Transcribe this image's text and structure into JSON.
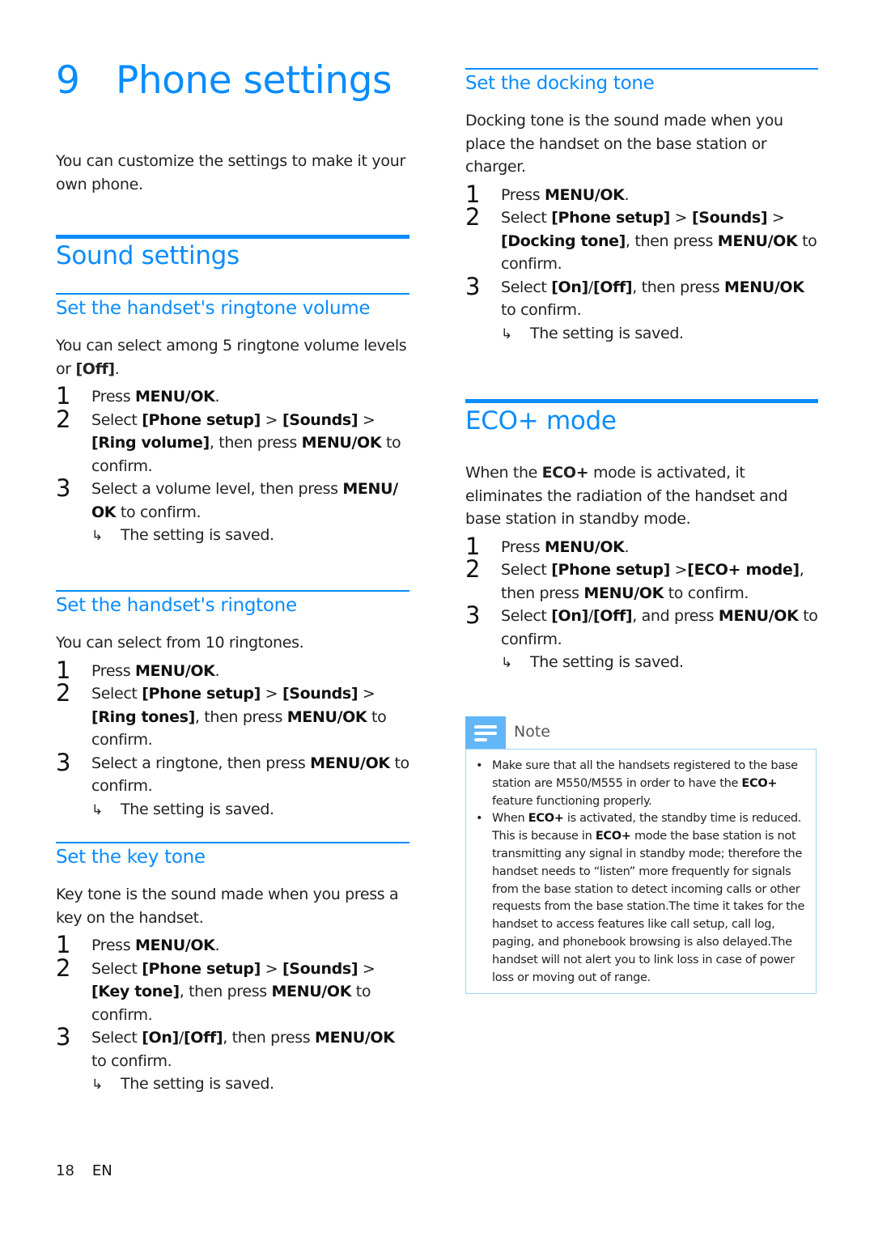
{
  "chapter": {
    "number": "9",
    "title": "Phone settings"
  },
  "intro": "You can customize the settings to make it your own phone.",
  "sound_settings": {
    "title": "Sound settings",
    "ringtone_volume": {
      "title": "Set the handset's ringtone volume",
      "description_pre": "You can select among 5 ringtone volume levels or ",
      "description_bold": "[Off]",
      "description_post": ".",
      "steps": [
        {
          "n": "1",
          "parts": [
            {
              "t": "Press "
            },
            {
              "b": "MENU/OK"
            },
            {
              "t": "."
            }
          ]
        },
        {
          "n": "2",
          "parts": [
            {
              "t": "Select "
            },
            {
              "b": "[Phone setup]"
            },
            {
              "t": " > "
            },
            {
              "b": "[Sounds]"
            },
            {
              "t": " > "
            },
            {
              "b": "[Ring volume]"
            },
            {
              "t": ", then press "
            },
            {
              "b": "MENU/OK"
            },
            {
              "t": " to confirm."
            }
          ]
        },
        {
          "n": "3",
          "parts": [
            {
              "t": "Select a volume level, then press "
            },
            {
              "b": "MENU/ OK"
            },
            {
              "t": " to confirm."
            }
          ]
        }
      ],
      "result": "The setting is saved."
    },
    "ringtone": {
      "title": "Set the handset's ringtone",
      "description": "You can select from 10 ringtones.",
      "steps": [
        {
          "n": "1",
          "parts": [
            {
              "t": "Press "
            },
            {
              "b": "MENU/OK"
            },
            {
              "t": "."
            }
          ]
        },
        {
          "n": "2",
          "parts": [
            {
              "t": "Select "
            },
            {
              "b": "[Phone setup]"
            },
            {
              "t": " > "
            },
            {
              "b": "[Sounds]"
            },
            {
              "t": " > "
            },
            {
              "b": "[Ring tones]"
            },
            {
              "t": ", then press "
            },
            {
              "b": "MENU/OK"
            },
            {
              "t": " to confirm."
            }
          ]
        },
        {
          "n": "3",
          "parts": [
            {
              "t": "Select a ringtone, then press "
            },
            {
              "b": "MENU/OK"
            },
            {
              "t": " to confirm."
            }
          ]
        }
      ],
      "result": "The setting is saved."
    },
    "key_tone": {
      "title": "Set the key tone",
      "description": "Key tone is the sound made when you press a key on the handset.",
      "steps": [
        {
          "n": "1",
          "parts": [
            {
              "t": "Press "
            },
            {
              "b": "MENU/OK"
            },
            {
              "t": "."
            }
          ]
        },
        {
          "n": "2",
          "parts": [
            {
              "t": "Select "
            },
            {
              "b": "[Phone setup]"
            },
            {
              "t": " > "
            },
            {
              "b": "[Sounds]"
            },
            {
              "t": " > "
            },
            {
              "b": "[Key tone]"
            },
            {
              "t": ", then press "
            },
            {
              "b": "MENU/OK"
            },
            {
              "t": " to confirm."
            }
          ]
        },
        {
          "n": "3",
          "parts": [
            {
              "t": "Select "
            },
            {
              "b": "[On]"
            },
            {
              "t": "/"
            },
            {
              "b": "[Off]"
            },
            {
              "t": ", then press "
            },
            {
              "b": "MENU/OK"
            },
            {
              "t": " to confirm."
            }
          ]
        }
      ],
      "result": "The setting is saved."
    },
    "docking_tone": {
      "title": "Set the docking tone",
      "description": "Docking tone is the sound made when you place the handset on the base station or charger.",
      "steps": [
        {
          "n": "1",
          "parts": [
            {
              "t": "Press "
            },
            {
              "b": "MENU/OK"
            },
            {
              "t": "."
            }
          ]
        },
        {
          "n": "2",
          "parts": [
            {
              "t": "Select "
            },
            {
              "b": "[Phone setup]"
            },
            {
              "t": " > "
            },
            {
              "b": "[Sounds]"
            },
            {
              "t": " > "
            },
            {
              "b": "[Docking tone]"
            },
            {
              "t": ", then press "
            },
            {
              "b": "MENU/OK"
            },
            {
              "t": " to confirm."
            }
          ]
        },
        {
          "n": "3",
          "parts": [
            {
              "t": "Select "
            },
            {
              "b": "[On]"
            },
            {
              "t": "/"
            },
            {
              "b": "[Off]"
            },
            {
              "t": ", then press "
            },
            {
              "b": "MENU/OK"
            },
            {
              "t": " to confirm."
            }
          ]
        }
      ],
      "result": "The setting is saved."
    }
  },
  "eco_mode": {
    "title": "ECO+ mode",
    "description_parts": [
      {
        "t": "When the "
      },
      {
        "b": "ECO+"
      },
      {
        "t": " mode is activated, it eliminates the radiation of the handset and base station in standby mode."
      }
    ],
    "steps": [
      {
        "n": "1",
        "parts": [
          {
            "t": "Press "
          },
          {
            "b": "MENU/OK"
          },
          {
            "t": "."
          }
        ]
      },
      {
        "n": "2",
        "parts": [
          {
            "t": "Select "
          },
          {
            "b": "[Phone setup]"
          },
          {
            "t": " >"
          },
          {
            "b": "[ECO+ mode]"
          },
          {
            "t": ", then press "
          },
          {
            "b": "MENU/OK"
          },
          {
            "t": " to confirm."
          }
        ]
      },
      {
        "n": "3",
        "parts": [
          {
            "t": "Select "
          },
          {
            "b": "[On]"
          },
          {
            "t": "/"
          },
          {
            "b": "[Off]"
          },
          {
            "t": ", and press "
          },
          {
            "b": "MENU/OK"
          },
          {
            "t": " to confirm."
          }
        ]
      }
    ],
    "result": "The setting is saved."
  },
  "note": {
    "label": "Note",
    "icon": "note-lines-icon",
    "items": [
      [
        {
          "t": "Make sure that all the handsets registered to the base station are M550/M555 in order to have the "
        },
        {
          "b": "ECO+"
        },
        {
          "t": " feature functioning properly."
        }
      ],
      [
        {
          "t": "When "
        },
        {
          "b": "ECO+"
        },
        {
          "t": " is activated, the standby time is reduced. This is because in "
        },
        {
          "b": "ECO+"
        },
        {
          "t": " mode the base station is not transmitting any signal in standby mode; therefore the handset needs to “listen” more frequently for signals from the base station to detect incoming calls or other requests from the base station.The time it takes for the handset to access features like call setup, call log, paging, and phonebook browsing is also delayed.The handset will not alert you to link loss in case of power loss or moving out of range."
        }
      ]
    ]
  },
  "footer": {
    "page_number": "18",
    "language": "EN"
  },
  "colors": {
    "accent": "#0a8cff",
    "note_tab": "#62b6f8",
    "note_border": "#9fd4f4",
    "text": "#222222"
  },
  "result_arrow": "↳"
}
